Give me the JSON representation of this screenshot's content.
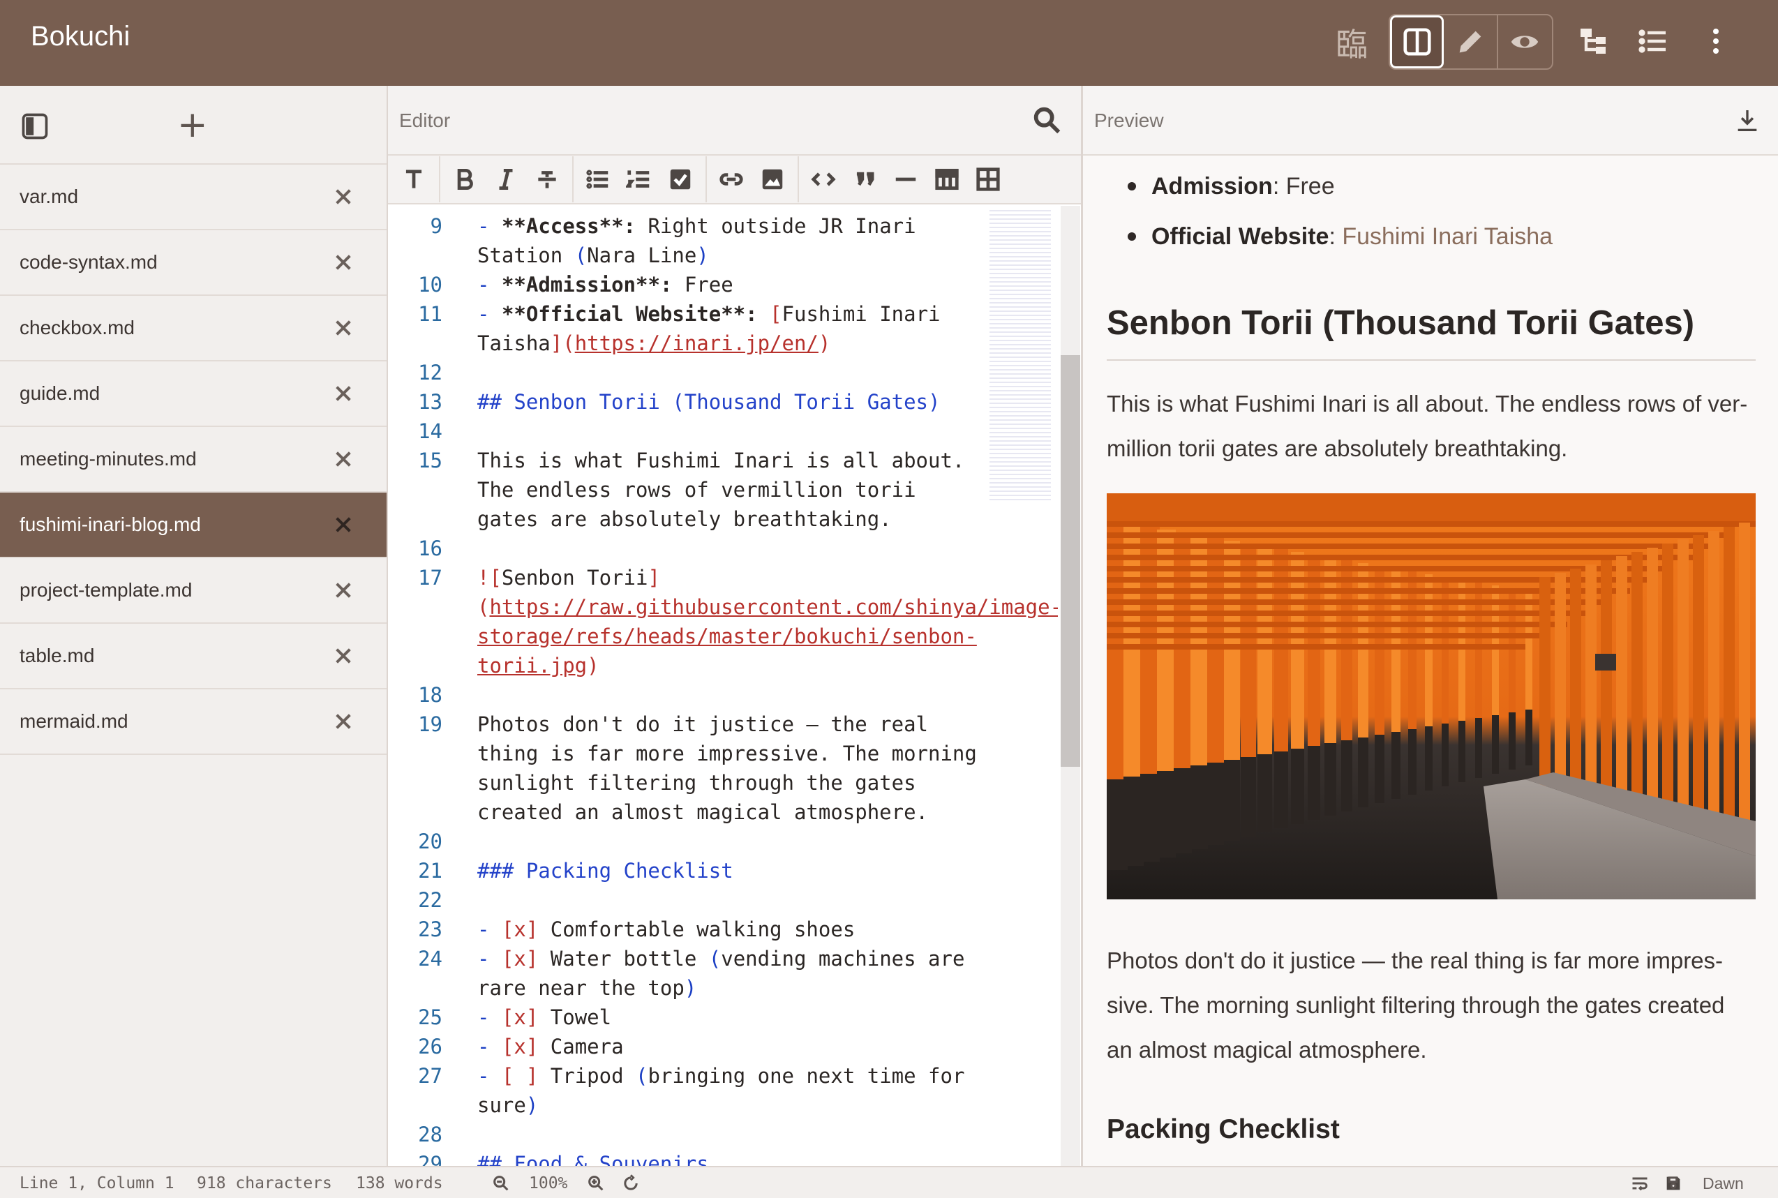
{
  "app": {
    "title": "Bokuchi",
    "kanji": "臨"
  },
  "topbar": {
    "icons": [
      "split-view-icon",
      "pencil-icon",
      "eye-icon",
      "tree-icon",
      "list-icon",
      "more-icon"
    ]
  },
  "sidebar": {
    "files": [
      {
        "name": "var.md",
        "active": false
      },
      {
        "name": "code-syntax.md",
        "active": false
      },
      {
        "name": "checkbox.md",
        "active": false
      },
      {
        "name": "guide.md",
        "active": false
      },
      {
        "name": "meeting-minutes.md",
        "active": false
      },
      {
        "name": "fushimi-inari-blog.md",
        "active": true
      },
      {
        "name": "project-template.md",
        "active": false
      },
      {
        "name": "table.md",
        "active": false
      },
      {
        "name": "mermaid.md",
        "active": false
      }
    ],
    "add_symbol": "+"
  },
  "editor": {
    "title": "Editor",
    "lines": [
      {
        "n": "9",
        "html": "<span class=\"c-punc\">-</span> <span class=\"c-bold\">**Access**:</span> Right outside JR Inari Station <span class=\"c-punc\">(</span>Nara Line<span class=\"c-punc\">)</span>"
      },
      {
        "n": "10",
        "html": "<span class=\"c-punc\">-</span> <span class=\"c-bold\">**Admission**:</span> Free"
      },
      {
        "n": "11",
        "html": "<span class=\"c-punc\">-</span> <span class=\"c-bold\">**Official Website**:</span> <span class=\"c-md\">[</span>Fushimi Inari Taisha<span class=\"c-md\">](</span><span class=\"c-link\">https://inari.jp/en/</span><span class=\"c-md\">)</span>"
      },
      {
        "n": "12",
        "html": ""
      },
      {
        "n": "13",
        "html": "<span class=\"c-head\">## Senbon Torii (Thousand Torii Gates)</span>"
      },
      {
        "n": "14",
        "html": ""
      },
      {
        "n": "15",
        "html": "This is what Fushimi Inari is all about. The endless rows of vermillion torii gates are absolutely breathtaking."
      },
      {
        "n": "16",
        "html": ""
      },
      {
        "n": "17",
        "html": "<span class=\"c-md\">![</span>Senbon Torii<span class=\"c-md\">](</span><span class=\"c-link\">https://raw.githubusercontent.com/shinya/image-storage/refs/heads/master/bokuchi/senbon-torii.jpg</span><span class=\"c-md\">)</span>"
      },
      {
        "n": "18",
        "html": ""
      },
      {
        "n": "19",
        "html": "Photos don't do it justice — the real thing is far more impressive. The morning sunlight filtering through the gates created an almost magical atmosphere."
      },
      {
        "n": "20",
        "html": ""
      },
      {
        "n": "21",
        "html": "<span class=\"c-head\">### Packing Checklist</span>"
      },
      {
        "n": "22",
        "html": ""
      },
      {
        "n": "23",
        "html": "<span class=\"c-punc\">-</span> <span class=\"c-md\">[x]</span> Comfortable walking shoes"
      },
      {
        "n": "24",
        "html": "<span class=\"c-punc\">-</span> <span class=\"c-md\">[x]</span> Water bottle <span class=\"c-punc\">(</span>vending machines are rare near the top<span class=\"c-punc\">)</span>"
      },
      {
        "n": "25",
        "html": "<span class=\"c-punc\">-</span> <span class=\"c-md\">[x]</span> Towel"
      },
      {
        "n": "26",
        "html": "<span class=\"c-punc\">-</span> <span class=\"c-md\">[x]</span> Camera"
      },
      {
        "n": "27",
        "html": "<span class=\"c-punc\">-</span> <span class=\"c-md\">[ ]</span> Tripod <span class=\"c-punc\">(</span>bringing one next time for sure<span class=\"c-punc\">)</span>"
      },
      {
        "n": "28",
        "html": ""
      },
      {
        "n": "29",
        "html": "<span class=\"c-head\">## Food &amp; Souvenirs</span>"
      }
    ]
  },
  "preview": {
    "title": "Preview",
    "list": [
      {
        "label": "Admission",
        "value": ": Free",
        "link": ""
      },
      {
        "label": "Official Website",
        "value": ": ",
        "link": "Fushimi Inari Taisha"
      }
    ],
    "h2": "Senbon Torii (Thousand Torii Gates)",
    "p1": "This is what Fushimi Inari is all about. The endless rows of ver-million torii gates are absolutely breathtaking.",
    "image_alt": "Senbon Torii",
    "p2": "Photos don't do it justice — the real thing is far more impres-sive. The morning sunlight filtering through the gates created an almost magical atmosphere.",
    "h3": "Packing Checklist"
  },
  "status": {
    "position": "Line 1, Column 1",
    "chars": "918 characters",
    "words": "138 words",
    "zoom": "100%",
    "theme": "Dawn"
  },
  "colors": {
    "topbar": "#785e50",
    "active_file": "#785e50",
    "link": "#8a6d5c"
  }
}
